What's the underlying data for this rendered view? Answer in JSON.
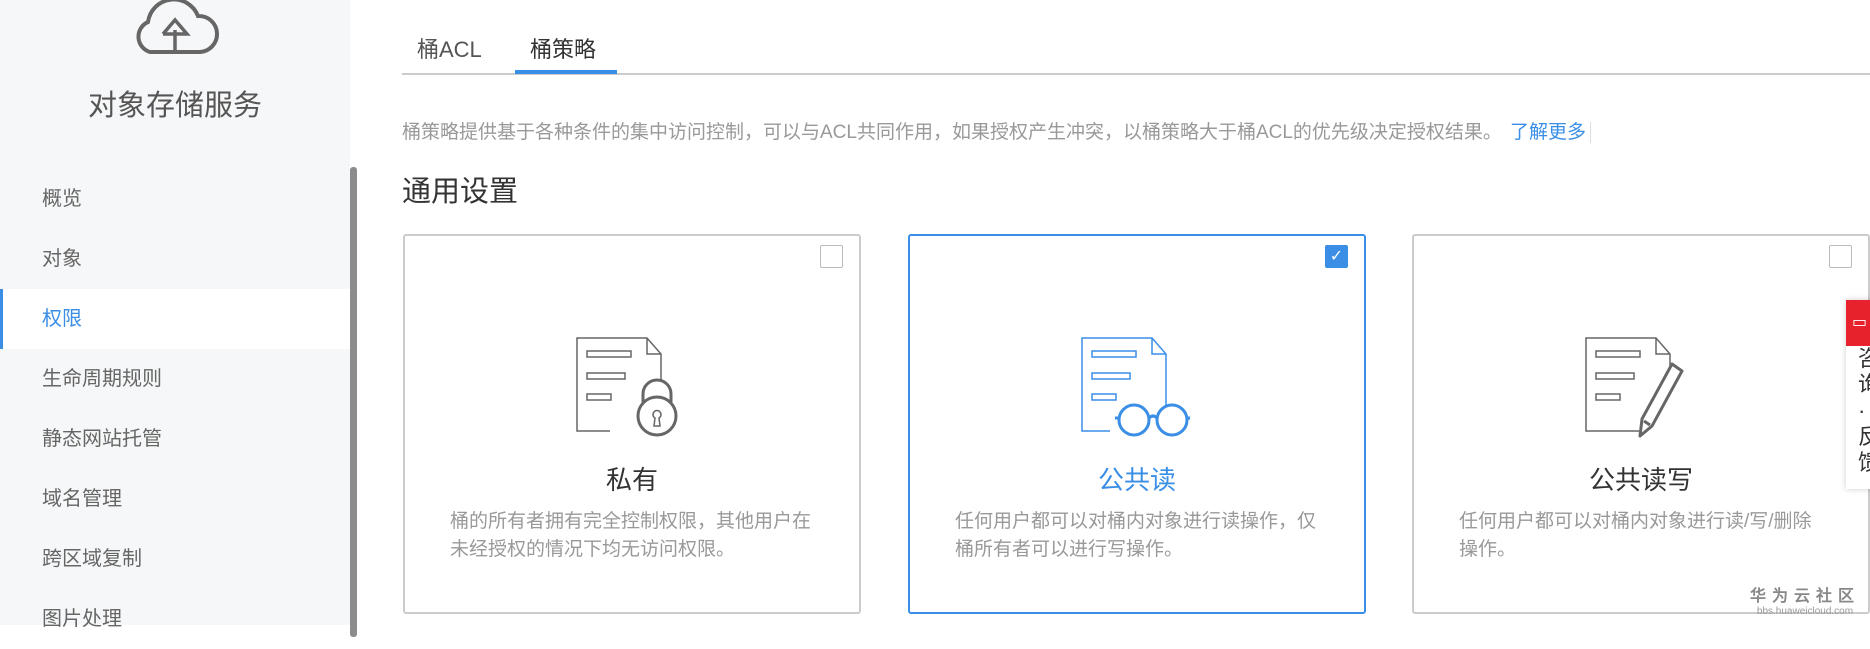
{
  "sidebar": {
    "title": "对象存储服务",
    "items": [
      {
        "label": "概览"
      },
      {
        "label": "对象"
      },
      {
        "label": "权限"
      },
      {
        "label": "生命周期规则"
      },
      {
        "label": "静态网站托管"
      },
      {
        "label": "域名管理"
      },
      {
        "label": "跨区域复制"
      },
      {
        "label": "图片处理"
      }
    ],
    "active": "权限"
  },
  "tabs": [
    {
      "label": "桶ACL"
    },
    {
      "label": "桶策略"
    }
  ],
  "active_tab": "桶策略",
  "description": "桶策略提供基于各种条件的集中访问控制，可以与ACL共同作用，如果授权产生冲突，以桶策略大于桶ACL的优先级决定授权结果。",
  "learn_more": "了解更多",
  "section_title": "通用设置",
  "cards": [
    {
      "title": "私有",
      "desc": "桶的所有者拥有完全控制权限，其他用户在未经授权的情况下均无访问权限。",
      "checked": false,
      "icon": "document-lock-icon"
    },
    {
      "title": "公共读",
      "desc": "任何用户都可以对桶内对象进行读操作，仅桶所有者可以进行写操作。",
      "checked": true,
      "icon": "document-glasses-icon"
    },
    {
      "title": "公共读写",
      "desc": "任何用户都可以对桶内对象进行读/写/删除操作。",
      "checked": false,
      "icon": "document-pencil-icon"
    }
  ],
  "float_widget": {
    "icon": "chat-icon",
    "label": "咨询·反馈"
  },
  "watermark": {
    "name": "华为云社区",
    "url": "bbs.huaweicloud.com"
  },
  "colors": {
    "accent": "#3a8ee6",
    "float_red": "#e8222c"
  }
}
